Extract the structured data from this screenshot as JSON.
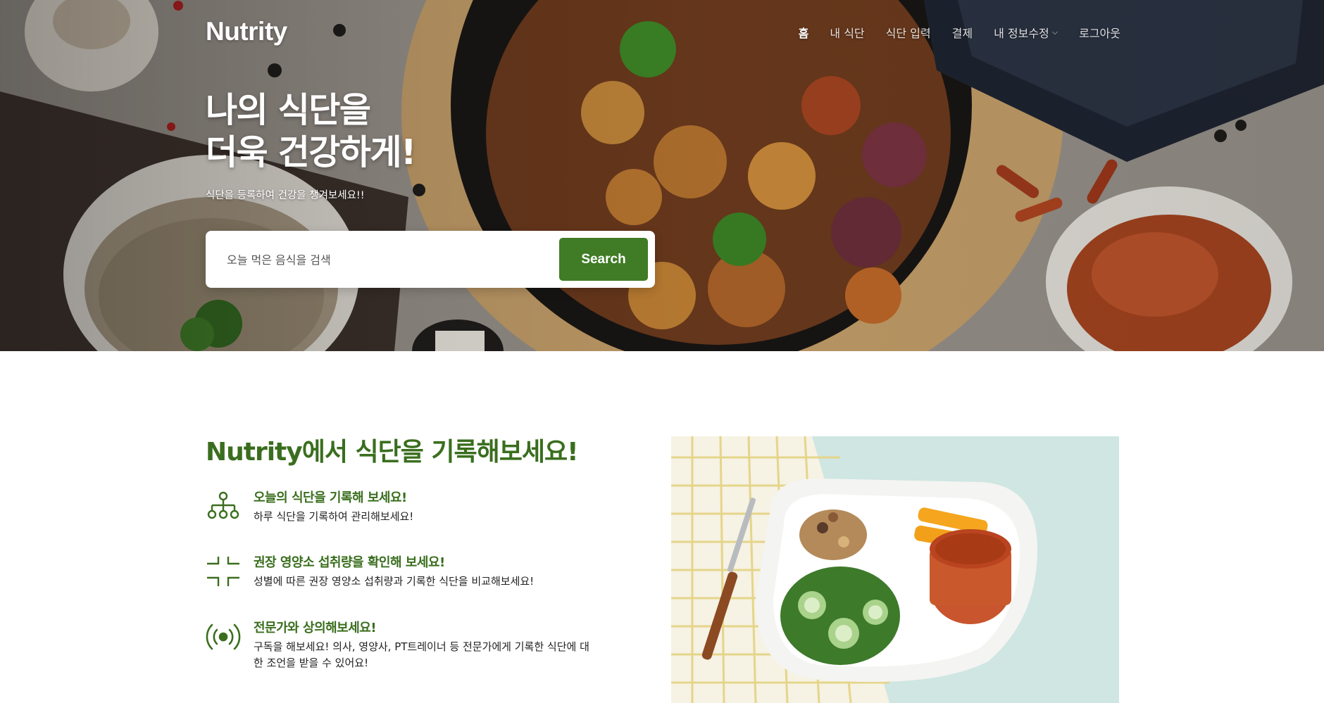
{
  "header": {
    "logo": "Nutrity",
    "nav": [
      {
        "label": "홈",
        "active": true
      },
      {
        "label": "내 식단",
        "active": false
      },
      {
        "label": "식단 입력",
        "active": false
      },
      {
        "label": "결제",
        "active": false
      },
      {
        "label": "내 정보수정",
        "active": false,
        "has_dropdown": true
      },
      {
        "label": "로그아웃",
        "active": false
      }
    ]
  },
  "hero": {
    "title_line1": "나의 식단을",
    "title_line2": "더욱 건강하게!",
    "subtitle": "식단을 등록하여 건강을 챙겨보세요!!",
    "search": {
      "placeholder": "오늘 먹은 음식을 검색",
      "button_label": "Search"
    }
  },
  "features": {
    "title": "Nutrity에서 식단을 기록해보세요!",
    "items": [
      {
        "icon": "sitemap-icon",
        "title": "오늘의 식단을 기록해 보세요!",
        "desc": "하루 식단을 기록하여 관리해보세요!"
      },
      {
        "icon": "corners-icon",
        "title": "권장 영양소 섭취량을 확인해 보세요!",
        "desc": "성별에 따른 권장 영양소 섭취량과 기록한 식단을 비교해보세요!"
      },
      {
        "icon": "broadcast-icon",
        "title": "전문가와 상의해보세요!",
        "desc": "구독을 해보세요! 의사, 영양사, PT트레이너 등 전문가에게 기록한 식단에 대한 조언을 받을 수 있어요!"
      }
    ]
  },
  "colors": {
    "accent_green": "#3f7c25",
    "heading_green": "#3a6e1e"
  }
}
